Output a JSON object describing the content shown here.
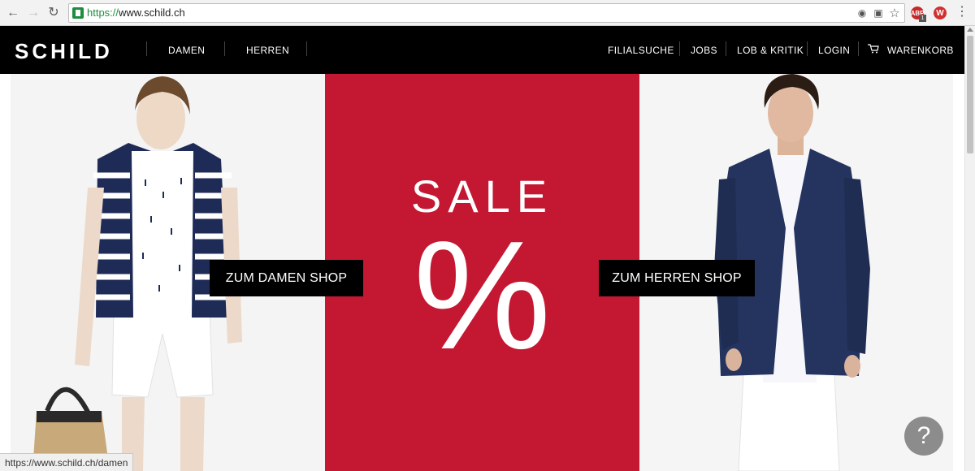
{
  "browser": {
    "url_scheme": "https://",
    "url_host": "www.schild.ch",
    "status_url": "https://www.schild.ch/damen",
    "ext_abp_label": "ABP",
    "ext_abp_badge": "1",
    "ext_w_label": "W"
  },
  "header": {
    "logo": "SCHILD",
    "nav_left": [
      "DAMEN",
      "HERREN"
    ],
    "nav_right": [
      "FILIALSUCHE",
      "JOBS",
      "LOB & KRITIK",
      "LOGIN",
      "WARENKORB"
    ]
  },
  "hero": {
    "sale_title": "SALE",
    "sale_symbol": "%",
    "women_button": "ZUM DAMEN SHOP",
    "men_button": "ZUM HERREN SHOP"
  },
  "help": {
    "label": "?"
  },
  "colors": {
    "sale_red": "#c41832",
    "header_bg": "#000000",
    "help_bg": "#8c8c8c"
  },
  "icons": [
    "back-arrow-icon",
    "forward-arrow-icon",
    "reload-icon",
    "lock-icon",
    "translate-icon",
    "star-icon",
    "menu-dots-icon",
    "cart-icon"
  ]
}
